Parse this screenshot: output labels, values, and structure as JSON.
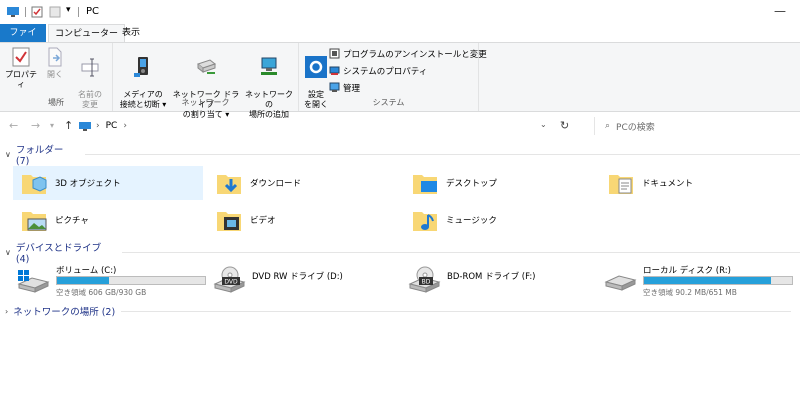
{
  "window": {
    "title": "PC",
    "minimize_glyph": "—"
  },
  "ribbon_tabs": [
    {
      "label": "ファイル"
    },
    {
      "label": "コンピューター"
    },
    {
      "label": "表示"
    }
  ],
  "ribbon": {
    "groups": {
      "location": {
        "label": "場所",
        "buttons": [
          {
            "label": "プロパティ",
            "enabled": true
          },
          {
            "label": "開く",
            "enabled": false
          },
          {
            "label": "名前の\n変更",
            "enabled": false
          }
        ]
      },
      "network": {
        "label": "ネットワーク",
        "buttons": [
          {
            "label": "メディアの\n接続と切断 ▾"
          },
          {
            "label": "ネットワーク ドライブ\nの割り当て ▾"
          },
          {
            "label": "ネットワークの\n場所の追加"
          }
        ]
      },
      "system": {
        "label": "システム",
        "settings_label": "設定\nを開く",
        "small_buttons": [
          {
            "label": "プログラムのアンインストールと変更"
          },
          {
            "label": "システムのプロパティ"
          },
          {
            "label": "管理"
          }
        ]
      }
    }
  },
  "address": {
    "path_root": "PC",
    "path_sep": "›",
    "search_placeholder": "PCの検索"
  },
  "sections": {
    "folders": {
      "label": "フォルダー (7)",
      "items": [
        {
          "label": "3D オブジェクト"
        },
        {
          "label": "ダウンロード"
        },
        {
          "label": "デスクトップ"
        },
        {
          "label": "ドキュメント"
        },
        {
          "label": "ピクチャ"
        },
        {
          "label": "ビデオ"
        },
        {
          "label": "ミュージック"
        }
      ]
    },
    "drives": {
      "label": "デバイスとドライブ (4)",
      "items": [
        {
          "label": "ボリューム (C:)",
          "free": "空き領域 606 GB/930 GB",
          "used_fraction": 0.35
        },
        {
          "label": "DVD RW ドライブ (D:)",
          "badge": "DVD"
        },
        {
          "label": "BD-ROM ドライブ (F:)",
          "badge": "BD"
        },
        {
          "label": "ローカル ディスク (R:)",
          "free": "空き領域 90.2 MB/651 MB",
          "used_fraction": 0.86
        }
      ]
    },
    "network_locations": {
      "label": "ネットワークの場所 (2)"
    }
  },
  "colors": {
    "accent": "#1979ca",
    "bar_fill": "#26a0da",
    "section_text": "#1e3287",
    "selected_bg": "#e5f3ff"
  }
}
